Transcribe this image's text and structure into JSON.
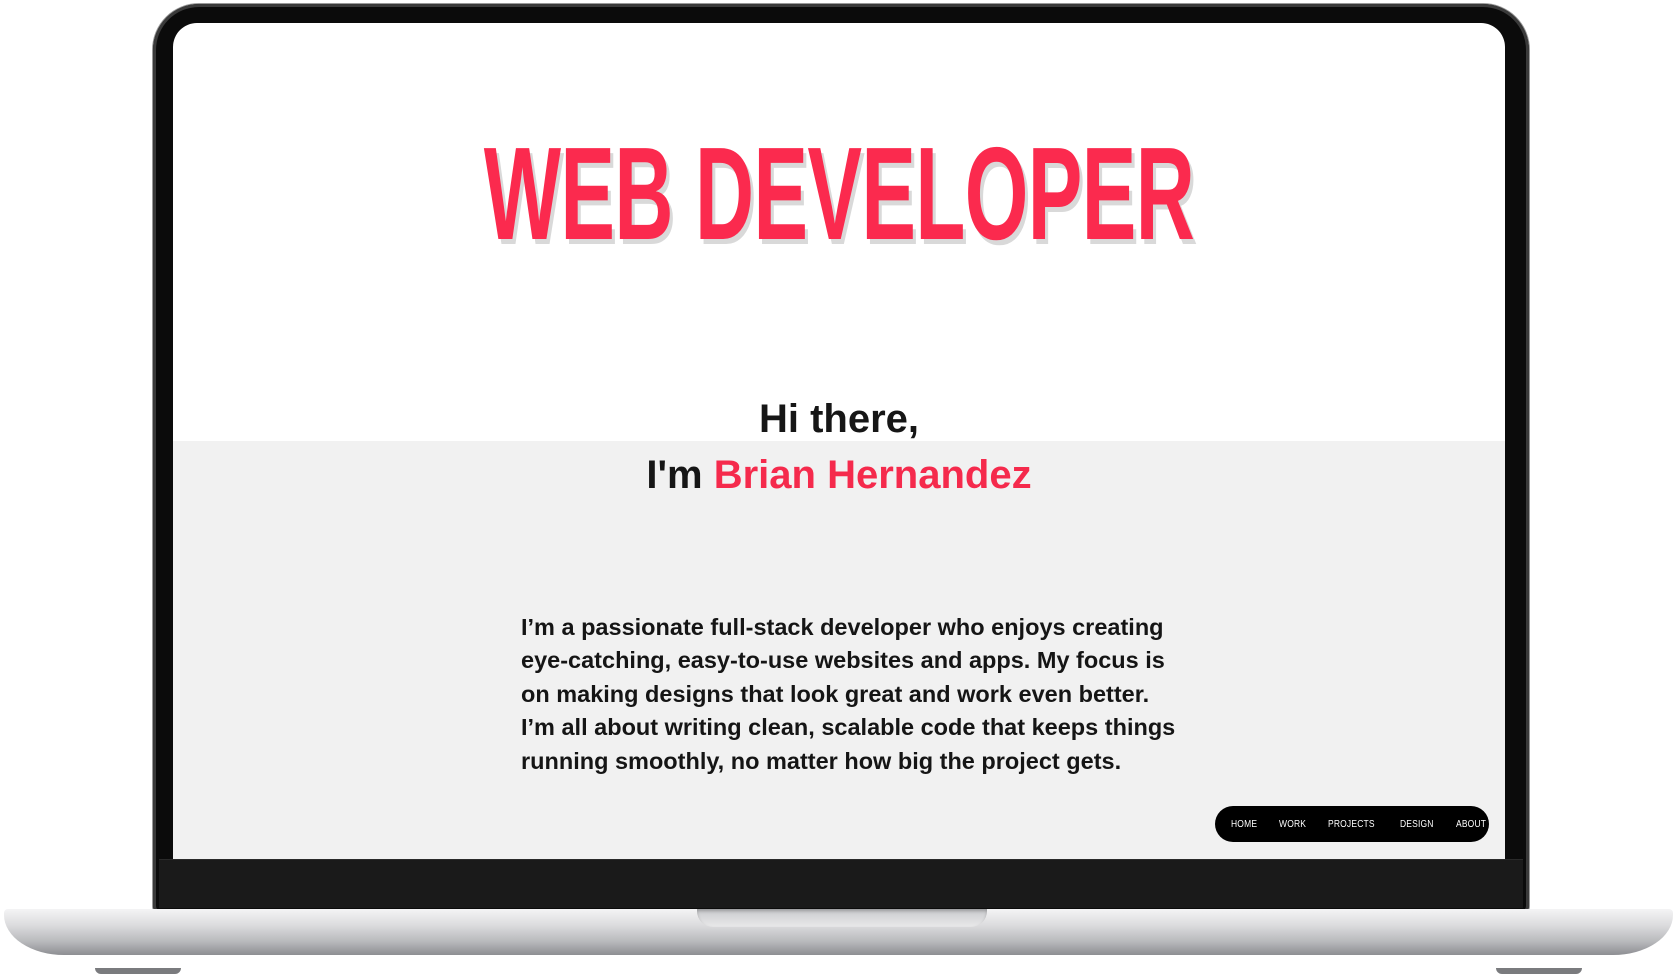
{
  "hero": {
    "title": "WEB DEVELOPER",
    "greeting_line1": "Hi there,",
    "greeting_prefix": "I'm ",
    "name": "Brian Hernandez",
    "bio": "I’m a passionate full-stack developer who enjoys creating eye-catching, easy-to-use websites and apps. My focus is on making designs that look great and work even better. I’m all about writing clean, scalable code that keeps things running smoothly, no matter how big the project gets."
  },
  "nav": {
    "items": [
      "HOME",
      "WORK",
      "PROJECTS",
      "DESIGN",
      "ABOUT"
    ],
    "arrow_icon": "arrow-right-icon"
  },
  "colors": {
    "accent": "#fb2a4e",
    "text": "#161616",
    "band": "#f1f1f1",
    "nav_bg": "#000000"
  }
}
